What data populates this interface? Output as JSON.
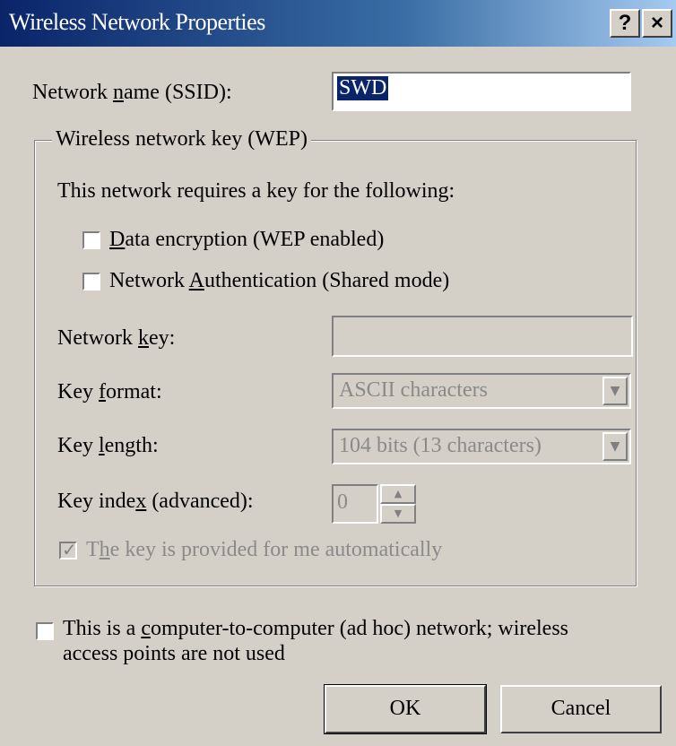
{
  "window": {
    "title": "Wireless Network Properties",
    "help_label": "?",
    "close_label": "×"
  },
  "ssid": {
    "label": "Network name (SSID):",
    "value": "SWD"
  },
  "wep": {
    "group_label": "Wireless network key (WEP)",
    "intro": "This network requires a key for the following:",
    "data_encryption": {
      "label": "Data encryption (WEP enabled)",
      "checked": false
    },
    "network_auth": {
      "label": "Network Authentication (Shared mode)",
      "checked": false
    },
    "network_key": {
      "label": "Network key:",
      "value": ""
    },
    "key_format": {
      "label": "Key format:",
      "value": "ASCII characters"
    },
    "key_length": {
      "label": "Key length:",
      "value": "104 bits (13 characters)"
    },
    "key_index": {
      "label": "Key index (advanced):",
      "value": "0"
    },
    "auto_key": {
      "label": "The key is provided for me automatically",
      "checked": true
    }
  },
  "adhoc": {
    "label_line1": "This is a computer-to-computer (ad hoc) network; wireless",
    "label_line2": "access points are not used",
    "checked": false
  },
  "buttons": {
    "ok": "OK",
    "cancel": "Cancel"
  },
  "icons": {
    "help": "help-icon",
    "close": "close-icon",
    "dropdown": "chevron-down-icon",
    "spin_up": "chevron-up-icon",
    "spin_down": "chevron-down-icon",
    "checkmark": "checkmark-icon"
  },
  "colors": {
    "titlebar_start": "#0a246a",
    "titlebar_end": "#a6caf0",
    "face": "#d4d0c8"
  }
}
